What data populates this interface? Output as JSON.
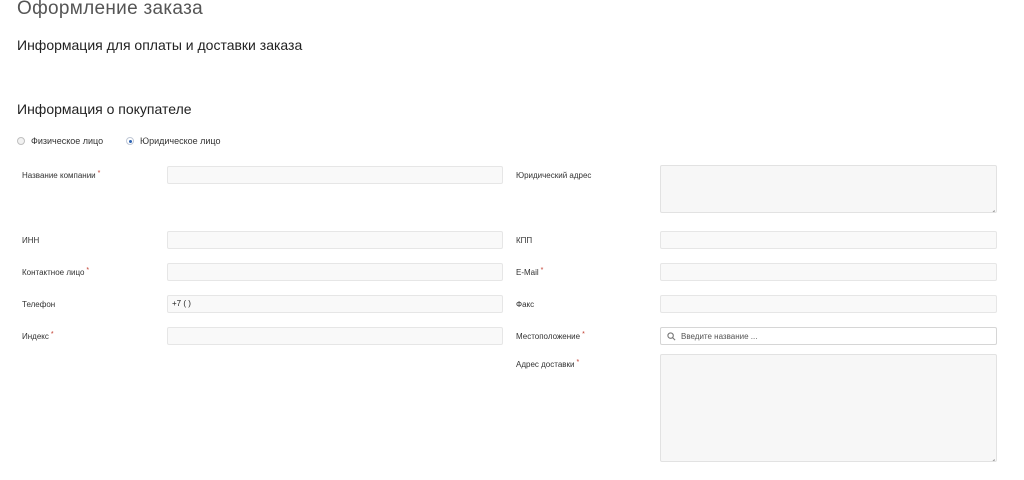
{
  "page": {
    "title": "Оформление заказа",
    "subtitle": "Информация для оплаты и доставки заказа",
    "section_title": "Информация о покупателе"
  },
  "person_type": {
    "options": [
      "Физическое лицо",
      "Юридическое лицо"
    ],
    "selected": "Юридическое лицо"
  },
  "required_mark": "*",
  "fields": {
    "company_name": {
      "label": "Название компании",
      "value": ""
    },
    "legal_address": {
      "label": "Юридический адрес",
      "value": ""
    },
    "inn": {
      "label": "ИНН",
      "value": ""
    },
    "kpp": {
      "label": "КПП",
      "value": ""
    },
    "contact_person": {
      "label": "Контактное лицо",
      "value": ""
    },
    "email": {
      "label": "E-Mail",
      "value": ""
    },
    "phone": {
      "label": "Телефон",
      "value": "+7 (      )"
    },
    "fax": {
      "label": "Факс",
      "value": ""
    },
    "zip": {
      "label": "Индекс",
      "value": ""
    },
    "location": {
      "label": "Местоположение",
      "placeholder": "Введите название ..."
    },
    "delivery_address": {
      "label": "Адрес доставки",
      "value": ""
    }
  }
}
